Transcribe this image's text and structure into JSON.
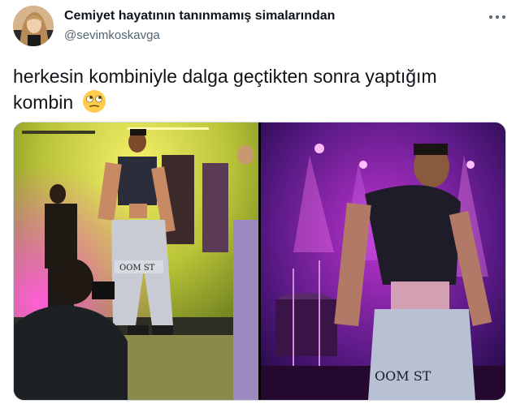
{
  "tweet": {
    "display_name": "Cemiyet hayatının tanınmamış simalarından",
    "handle": "@sevimkoskavga",
    "text_line1": "herkesin kombiniyle dalga geçtikten sonra yaptığım",
    "text_line2": "kombin",
    "emoji": "face-with-rolling-eyes",
    "media": {
      "left_photo": "concert-photo-performer-yellow-stage",
      "right_photo": "concert-photo-performer-purple-stage"
    }
  },
  "colors": {
    "text": "#0f1419",
    "secondary_text": "#536471",
    "border": "#cfd9de"
  }
}
